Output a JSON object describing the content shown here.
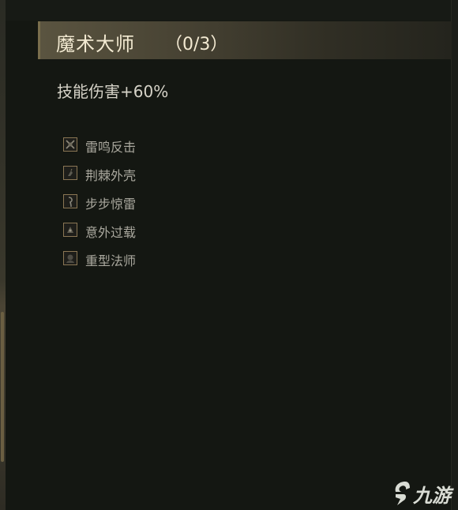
{
  "panel": {
    "title": "魔术大师",
    "count": "（0/3）",
    "bonus": "技能伤害+60%"
  },
  "skills": [
    {
      "label": "雷鸣反击",
      "icon": "thunder-counter-icon"
    },
    {
      "label": "荆棘外壳",
      "icon": "thorn-shell-icon"
    },
    {
      "label": "步步惊雷",
      "icon": "step-thunder-icon"
    },
    {
      "label": "意外过载",
      "icon": "overload-icon"
    },
    {
      "label": "重型法师",
      "icon": "heavy-mage-icon"
    }
  ],
  "watermark": {
    "text": "九游"
  },
  "colors": {
    "background": "#141712",
    "title_bar": "#5a5440",
    "title_text": "#f3ead2",
    "bonus_text": "#d6d3c8",
    "skill_text": "#aaa89e",
    "icon_border": "#8a7654"
  }
}
